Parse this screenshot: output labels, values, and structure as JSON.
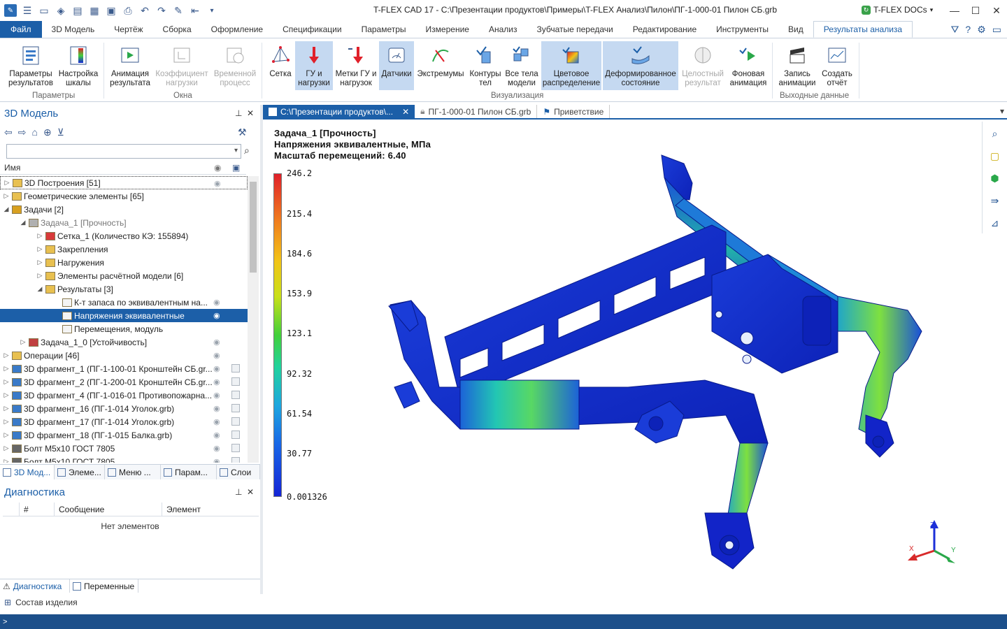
{
  "window": {
    "title": "T-FLEX CAD 17 - C:\\Презентации продуктов\\Примеры\\T-FLEX Анализ\\Пилон\\ПГ-1-000-01 Пилон СБ.grb",
    "docs_label": "T-FLEX DOCs",
    "controls": [
      "—",
      "☐",
      "✕"
    ]
  },
  "ribbon_tabs": [
    "Файл",
    "3D Модель",
    "Чертёж",
    "Сборка",
    "Оформление",
    "Спецификации",
    "Параметры",
    "Измерение",
    "Анализ",
    "Зубчатые передачи",
    "Редактирование",
    "Инструменты",
    "Вид",
    "Результаты анализа"
  ],
  "ribbon": {
    "buttons": [
      {
        "line1": "Параметры",
        "line2": "результатов",
        "icon": "result-params-icon"
      },
      {
        "line1": "Настройка",
        "line2": "шкалы",
        "icon": "scale-settings-icon"
      },
      {
        "line1": "Анимация",
        "line2": "результата",
        "icon": "animation-icon"
      },
      {
        "line1": "Коэффициент",
        "line2": "нагрузки",
        "icon": "load-factor-icon"
      },
      {
        "line1": "Временной",
        "line2": "процесс",
        "icon": "time-process-icon"
      },
      {
        "line1": "Сетка",
        "line2": "",
        "icon": "mesh-icon"
      },
      {
        "line1": "ГУ и",
        "line2": "нагрузки",
        "icon": "bc-loads-icon"
      },
      {
        "line1": "Метки ГУ и",
        "line2": "нагрузок",
        "icon": "bc-markers-icon"
      },
      {
        "line1": "Датчики",
        "line2": "",
        "icon": "sensors-icon"
      },
      {
        "line1": "Экстремумы",
        "line2": "",
        "icon": "extremes-icon"
      },
      {
        "line1": "Контуры",
        "line2": "тел",
        "icon": "contours-icon"
      },
      {
        "line1": "Все тела",
        "line2": "модели",
        "icon": "all-bodies-icon"
      },
      {
        "line1": "Цветовое",
        "line2": "распределение",
        "icon": "color-distribution-icon"
      },
      {
        "line1": "Деформированное",
        "line2": "состояние",
        "icon": "deformed-state-icon"
      },
      {
        "line1": "Целостный",
        "line2": "результат",
        "icon": "whole-result-icon"
      },
      {
        "line1": "Фоновая",
        "line2": "анимация",
        "icon": "background-animation-icon"
      },
      {
        "line1": "Запись",
        "line2": "анимации",
        "icon": "record-animation-icon"
      },
      {
        "line1": "Создать",
        "line2": "отчёт",
        "icon": "create-report-icon"
      }
    ],
    "groups": [
      "Параметры",
      "Окна",
      "Визуализация",
      "Выходные данные"
    ]
  },
  "left_panel": {
    "title": "3D Модель",
    "tree_header": "Имя",
    "rows": [
      {
        "label": "3D Построения [51]",
        "level": 0,
        "exp": "▷"
      },
      {
        "label": "Геометрические элементы [65]",
        "level": 0,
        "exp": "▷"
      },
      {
        "label": "Задачи [2]",
        "level": 0,
        "exp": "◢"
      },
      {
        "label": "Задача_1 [Прочность]",
        "level": 1,
        "exp": "◢"
      },
      {
        "label": "Сетка_1 (Количество КЭ: 155894)",
        "level": 2,
        "exp": "▷"
      },
      {
        "label": "Закрепления",
        "level": 2,
        "exp": "▷"
      },
      {
        "label": "Нагружения",
        "level": 2,
        "exp": "▷"
      },
      {
        "label": "Элементы расчётной модели [6]",
        "level": 2,
        "exp": "▷"
      },
      {
        "label": "Результаты [3]",
        "level": 2,
        "exp": "◢"
      },
      {
        "label": "К-т запаса по эквивалентным на...",
        "level": 3,
        "exp": ""
      },
      {
        "label": "Напряжения эквивалентные",
        "level": 3,
        "exp": ""
      },
      {
        "label": "Перемещения, модуль",
        "level": 3,
        "exp": ""
      },
      {
        "label": "Задача_1_0 [Устойчивость]",
        "level": 1,
        "exp": "▷"
      },
      {
        "label": "Операции [46]",
        "level": 0,
        "exp": "▷"
      },
      {
        "label": "3D фрагмент_1 (ПГ-1-100-01 Кронштейн СБ.gr...",
        "level": 0,
        "exp": "▷"
      },
      {
        "label": "3D фрагмент_2 (ПГ-1-200-01 Кронштейн СБ.gr...",
        "level": 0,
        "exp": "▷"
      },
      {
        "label": "3D фрагмент_4 (ПГ-1-016-01 Противопожарна...",
        "level": 0,
        "exp": "▷"
      },
      {
        "label": "3D фрагмент_16 (ПГ-1-014 Уголок.grb)",
        "level": 0,
        "exp": "▷"
      },
      {
        "label": "3D фрагмент_17 (ПГ-1-014 Уголок.grb)",
        "level": 0,
        "exp": "▷"
      },
      {
        "label": "3D фрагмент_18 (ПГ-1-015 Балка.grb)",
        "level": 0,
        "exp": "▷"
      },
      {
        "label": "Болт М5х10 ГОСТ 7805",
        "level": 0,
        "exp": "▷"
      },
      {
        "label": "Болт М5х10 ГОСТ 7805",
        "level": 0,
        "exp": "▷"
      }
    ],
    "bottom_tabs": [
      "3D Мод...",
      "Элеме...",
      "Меню ...",
      "Парам...",
      "Слои"
    ]
  },
  "diagnostics": {
    "title": "Диагностика",
    "columns": [
      "#",
      "Сообщение",
      "Элемент"
    ],
    "empty_text": "Нет элементов",
    "tabs": [
      "Диагностика",
      "Переменные"
    ]
  },
  "status": {
    "item": "Состав изделия",
    "prompt": ">"
  },
  "doc_tabs": [
    {
      "label": "C:\\Презентации продуктов\\...",
      "active": true
    },
    {
      "label": "ПГ-1-000-01 Пилон СБ.grb",
      "active": false
    },
    {
      "label": "Приветствие",
      "active": false
    }
  ],
  "viewport": {
    "line1": "Задача_1 [Прочность]",
    "line2": "Напряжения эквивалентные, МПа",
    "line3": "Масштаб перемещений: 6.40",
    "scale_values": [
      "246.2",
      "215.4",
      "184.6",
      "153.9",
      "123.1",
      "92.32",
      "61.54",
      "30.77",
      "0.001326"
    ],
    "axes": {
      "x": "X",
      "y": "Y",
      "z": "Z"
    }
  },
  "colors": {
    "accent": "#1c5fa8",
    "selected_bg": "#c5d9f1",
    "statusbar": "#1c4f8a"
  }
}
